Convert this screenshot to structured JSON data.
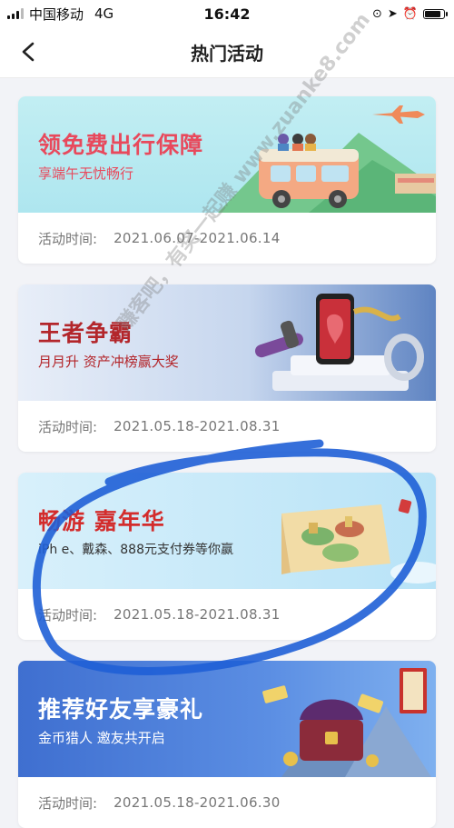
{
  "status_bar": {
    "carrier": "中国移动",
    "network": "4G",
    "time": "16:42"
  },
  "nav": {
    "title": "热门活动"
  },
  "cards": [
    {
      "title": "领免费出行保障",
      "subtitle": "享端午无忧畅行",
      "time_label": "活动时间:",
      "time_value": "2021.06.07-2021.06.14",
      "accent": "#e8495c"
    },
    {
      "title": "王者争霸",
      "subtitle": "月月升  资产冲榜赢大奖",
      "time_label": "活动时间:",
      "time_value": "2021.05.18-2021.08.31",
      "accent": "#b3262b"
    },
    {
      "title": "畅游  嘉年华",
      "subtitle": "iPh  e、戴森、888元支付券等你赢",
      "time_label": "活动时间:",
      "time_value": "2021.05.18-2021.08.31",
      "accent": "#d32c2c"
    },
    {
      "title": "推荐好友享豪礼",
      "subtitle": "金币猎人  邀友共开启",
      "time_label": "活动时间:",
      "time_value": "2021.05.18-2021.06.30",
      "accent": "#ffffff"
    }
  ],
  "watermark": "赚客吧，有奖一起赚 www.zuanke8.com",
  "highlight_color": "#1f5fd6"
}
